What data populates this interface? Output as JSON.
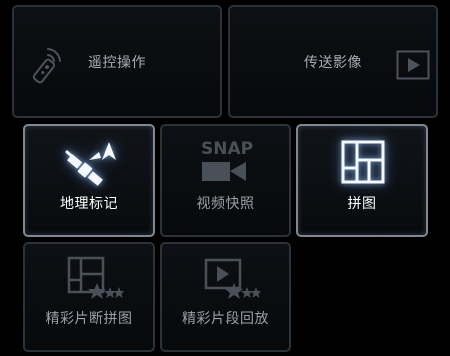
{
  "tiles": {
    "remote_control": {
      "label": "遥控操作",
      "icon": "remote-control-icon"
    },
    "send_images": {
      "label": "传送影像",
      "icon": "play-screen-icon"
    },
    "geotag": {
      "label": "地理标记",
      "icon": "satellite-geotag-icon"
    },
    "video_snapshot": {
      "label": "视频快照",
      "icon": "snap-camera-icon",
      "icon_text": "SNAP"
    },
    "collage": {
      "label": "拼图",
      "icon": "collage-grid-icon"
    },
    "highlight_collage": {
      "label": "精彩片断拼图",
      "icon": "collage-stars-icon"
    },
    "highlight_playback": {
      "label": "精彩片段回放",
      "icon": "playback-stars-icon"
    }
  },
  "colors": {
    "background": "#000000",
    "tile_border": "#2c323a",
    "active_border": "#7d8891",
    "active_label": "#ffffff",
    "inactive_label": "#9aa0a6",
    "glow": "#a0c8ff"
  }
}
